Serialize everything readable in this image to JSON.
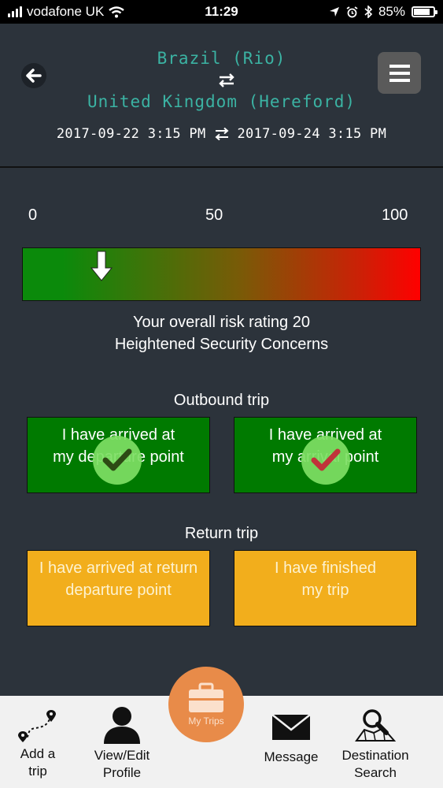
{
  "status_bar": {
    "carrier": "vodafone UK",
    "time": "11:29",
    "battery": "85%",
    "battery_level": 0.85
  },
  "header": {
    "from": "Brazil (Rio)",
    "to": "United Kingdom (Hereford)",
    "depart_date": "2017-09-22 3:15 PM",
    "return_date": "2017-09-24 3:15 PM"
  },
  "risk": {
    "scale_min": "0",
    "scale_mid": "50",
    "scale_max": "100",
    "rating_value": 20,
    "rating_text": "Your overall risk rating 20",
    "level_text": "Heightened Security Concerns",
    "colors": {
      "low": "#0b8a0b",
      "mid": "#7a5a07",
      "high": "#ff0000"
    }
  },
  "outbound": {
    "title": "Outbound trip",
    "cards": [
      {
        "line1": "I have arrived at",
        "line2": "my departure point",
        "check_color": "#2d4a14"
      },
      {
        "line1": "I have arrived at",
        "line2": "my arrival point",
        "check_color": "#c0333a"
      }
    ]
  },
  "return": {
    "title": "Return trip",
    "cards": [
      {
        "line1": "I have arrived at return",
        "line2": "departure point"
      },
      {
        "line1": "I have finished",
        "line2": "my trip"
      }
    ]
  },
  "tabs": {
    "add_trip": {
      "line1": "Add a",
      "line2": "trip",
      "icon": "route-icon"
    },
    "profile": {
      "line1": "View/Edit",
      "line2": "Profile",
      "icon": "user-icon"
    },
    "my_trips": {
      "label": "My Trips",
      "icon": "briefcase-icon"
    },
    "message": {
      "label": "Message",
      "icon": "envelope-icon"
    },
    "destination": {
      "line1": "Destination",
      "line2": "Search",
      "icon": "map-search-icon"
    }
  }
}
